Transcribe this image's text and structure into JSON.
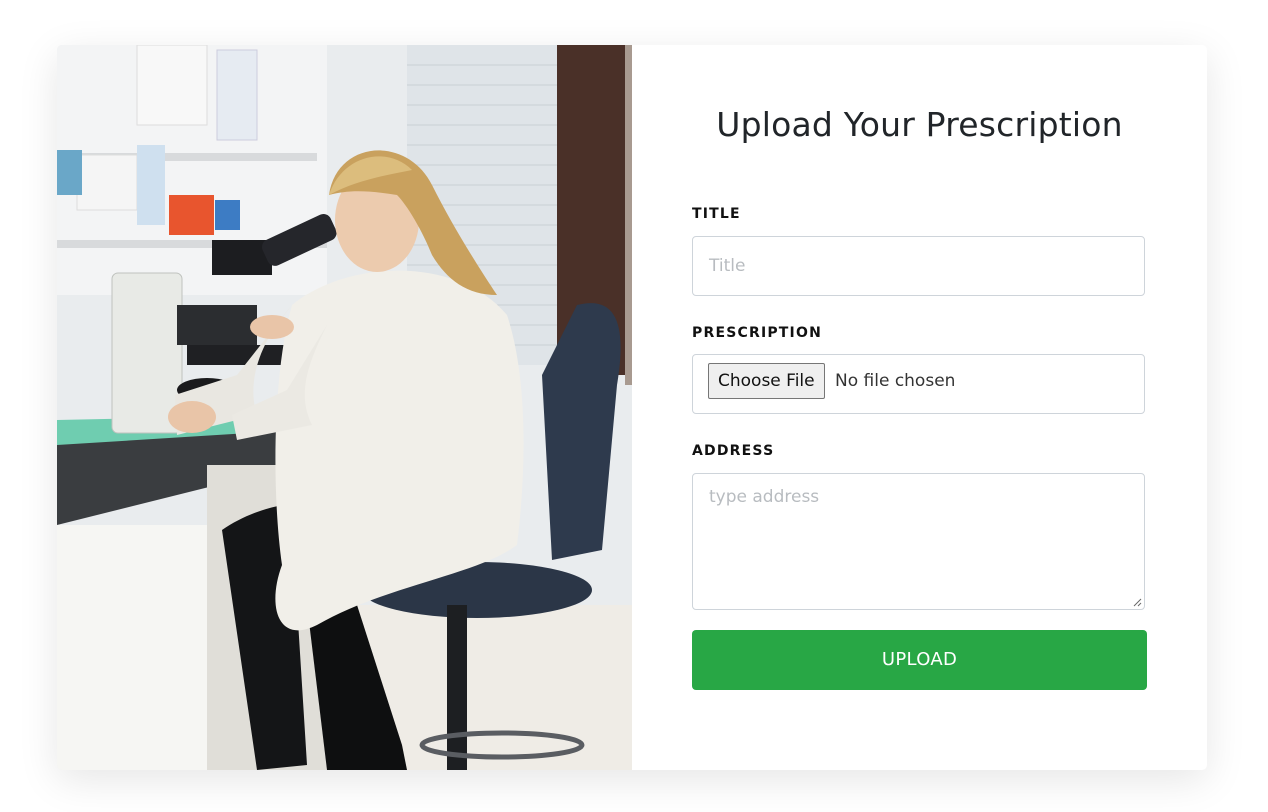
{
  "form": {
    "title": "Upload Your Prescription",
    "fields": {
      "title_label": "TITLE",
      "title_placeholder": "Title",
      "prescription_label": "PRESCRIPTION",
      "file_button": "Choose File",
      "file_status": "No file chosen",
      "address_label": "ADDRESS",
      "address_placeholder": "type address"
    },
    "submit_label": "UPLOAD"
  },
  "colors": {
    "submit": "#28a745",
    "border": "#ced4da",
    "title_text": "#212529"
  },
  "icons": {
    "textarea_resize": "resize-grip-icon"
  }
}
